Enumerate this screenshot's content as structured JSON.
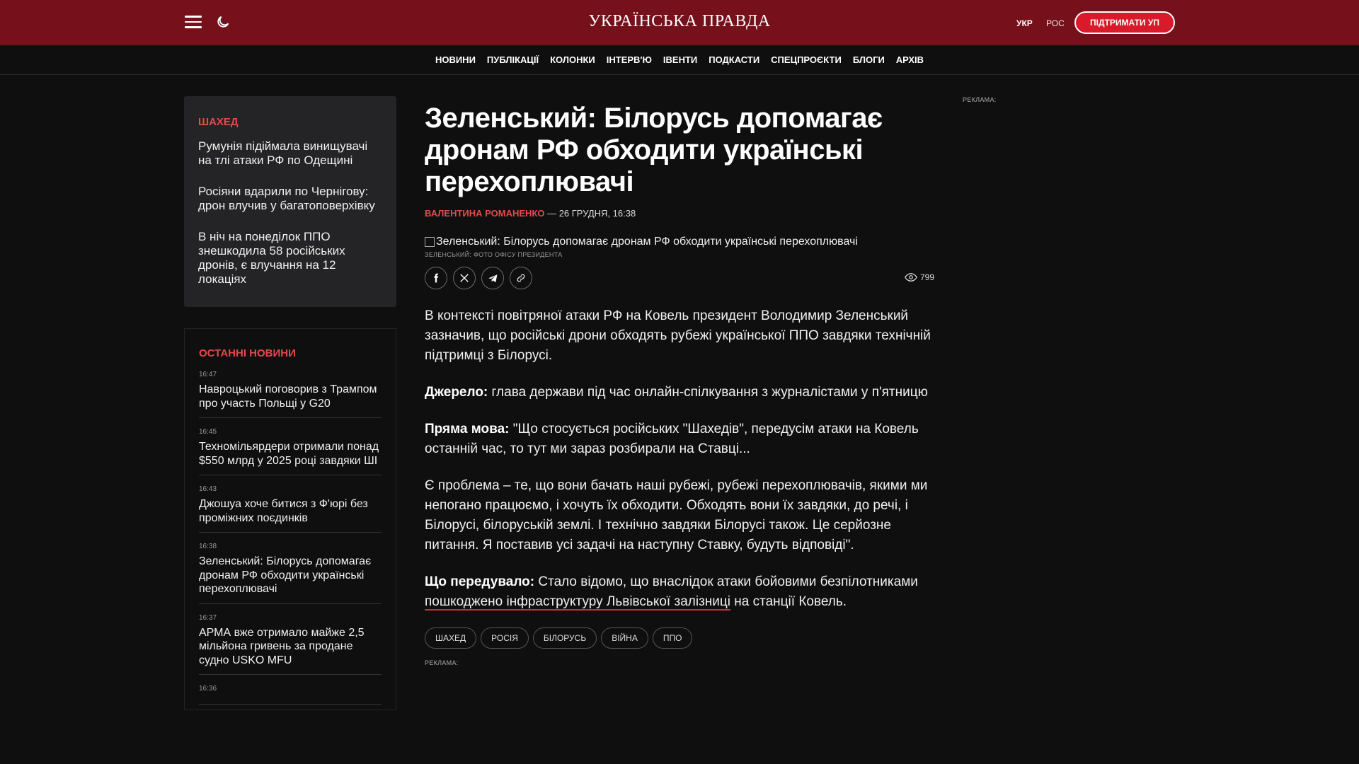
{
  "header": {
    "logo": "УКРАЇНСЬКА ПРАВДА",
    "lang_ukr": "УКР",
    "lang_ros": "РОС",
    "support_label": "ПІДТРИМАТИ УП"
  },
  "nav": [
    "НОВИНИ",
    "ПУБЛІКАЦІЇ",
    "КОЛОНКИ",
    "ІНТЕРВ'Ю",
    "ІВЕНТИ",
    "ПОДКАСТИ",
    "СПЕЦПРОЄКТИ",
    "БЛОГИ",
    "АРХІВ"
  ],
  "topic": {
    "heading": "ШАХЕД",
    "items": [
      "Румунія підіймала винищувачі на тлі атаки РФ по Одещині",
      "Росіяни вдарили по Чернігову: дрон влучив у багатоповерхівку",
      "В ніч на понеділок ППО знешкодила 58 російських дронів, є влучання на 12 локаціях"
    ]
  },
  "latest": {
    "heading": "ОСТАННІ НОВИНИ",
    "items": [
      {
        "time": "16:47",
        "title": "Навроцький поговорив з Трампом про участь Польщі у G20"
      },
      {
        "time": "16:45",
        "title": "Техномільярдери отримали понад $550 млрд у 2025 році завдяки ШІ"
      },
      {
        "time": "16:43",
        "title": "Джошуа хоче битися з Ф'юрі без проміжних поєдинків"
      },
      {
        "time": "16:38",
        "title": "Зеленський: Білорусь допомагає дронам РФ обходити українські перехоплювачі"
      },
      {
        "time": "16:37",
        "title": "АРМА вже отримало майже 2,5 мільйона гривень за продане судно USKO MFU"
      },
      {
        "time": "16:36",
        "title": ""
      }
    ]
  },
  "article": {
    "title": "Зеленський: Білорусь допомагає дронам РФ обходити українські перехоплювачі",
    "author": "ВАЛЕНТИНА РОМАНЕНКО",
    "date": " — 26 ГРУДНЯ, 16:38",
    "photo_alt": "Зеленський: Білорусь допомагає дронам РФ обходити українські перехоплювачі",
    "caption": "ЗЕЛЕНСЬКИЙ: ФОТО ОФІСУ ПРЕЗИДЕНТА",
    "views": "799",
    "p1": "В контексті повітряної атаки РФ на Ковель президент Володимир Зеленський зазначив, що російські дрони обходять рубежі української ППО завдяки технічній підтримці з Білорусі.",
    "p2_label": "Джерело:",
    "p2": " глава держави під час онлайн-спілкування з журналістами у п'ятницю",
    "p3_label": "Пряма мова:",
    "p3": " \"Що стосується російських \"Шахедів\", передусім атаки на Ковель останній час, то тут ми зараз розбирали на Ставці...",
    "p4": "Є проблема – те, що вони бачать наші рубежі, рубежі перехоплювачів, якими ми непогано працюємо, і хочуть їх обходити. Обходять вони їх завдяки, до речі, і Білорусі, білоруській землі. І технічно завдяки Білорусі також. Це серйозне питання. Я поставив усі задачі на наступну Ставку, будуть відповіді\".",
    "p5_label": "Що передувало:",
    "p5_pre": " Стало відомо, що внаслідок атаки бойовими безпілотниками ",
    "p5_link": "пошкоджено інфраструктуру Львівської залізниці",
    "p5_post": " на станції Ковель.",
    "tags": [
      "ШАХЕД",
      "РОСІЯ",
      "БІЛОРУСЬ",
      "ВІЙНА",
      "ППО"
    ]
  },
  "ads": {
    "label": "РЕКЛАМА:"
  },
  "colors": {
    "header_bg": "#76101b",
    "accent": "#e34a4a",
    "support_btn": "#d91a2a",
    "page_bg": "#0f0f10"
  },
  "icons": {
    "menu": "hamburger-icon",
    "theme": "moon-icon",
    "facebook": "facebook-icon",
    "x": "x-icon",
    "telegram": "telegram-icon",
    "link": "link-icon",
    "views": "eye-icon"
  }
}
